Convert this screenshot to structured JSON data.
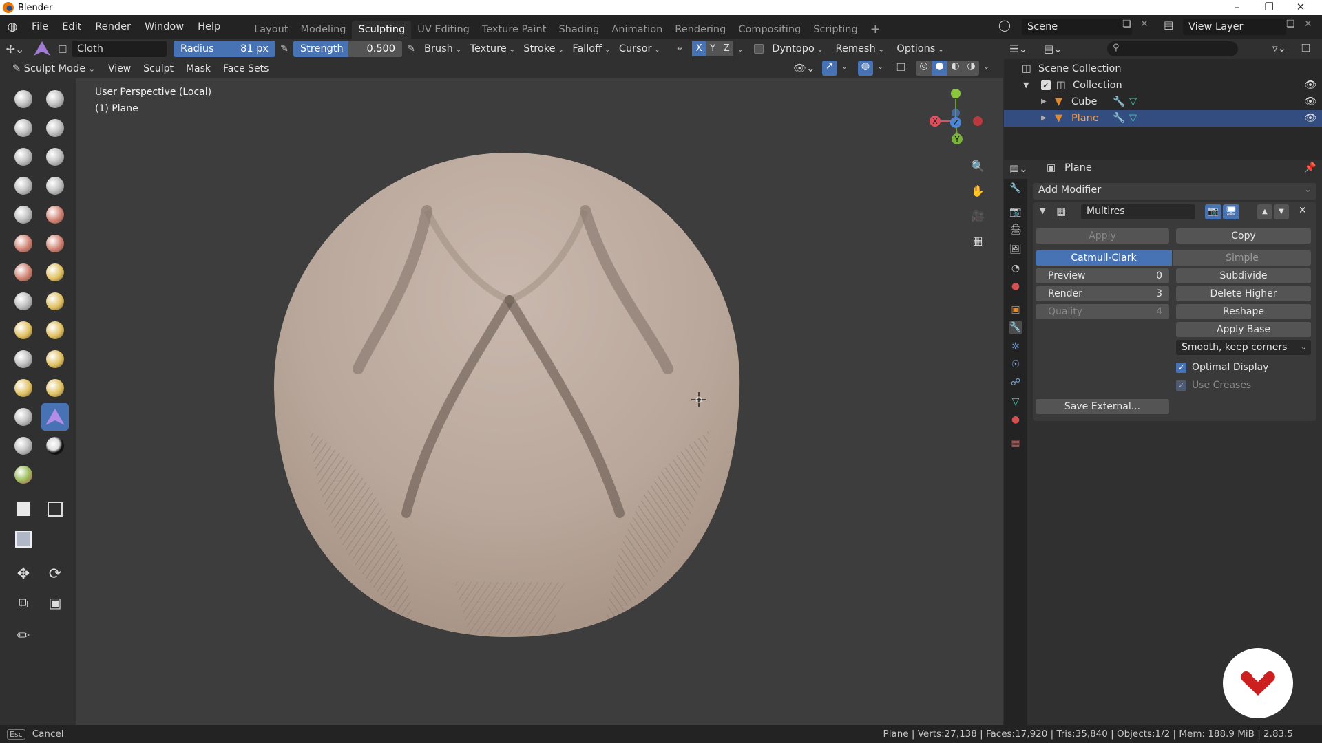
{
  "titlebar": {
    "app_title": "Blender"
  },
  "menu": {
    "items": [
      "File",
      "Edit",
      "Render",
      "Window",
      "Help"
    ]
  },
  "workspaces": {
    "tabs": [
      "Layout",
      "Modeling",
      "Sculpting",
      "UV Editing",
      "Texture Paint",
      "Shading",
      "Animation",
      "Rendering",
      "Compositing",
      "Scripting"
    ],
    "active": "Sculpting",
    "add_label": "+"
  },
  "scene": {
    "name": "Scene",
    "view_layer": "View Layer"
  },
  "brush_header": {
    "brush_name": "Cloth",
    "radius_label": "Radius",
    "radius_value": "81 px",
    "strength_label": "Strength",
    "strength_value": "0.500",
    "dropdowns": [
      "Brush",
      "Texture",
      "Stroke",
      "Falloff",
      "Cursor"
    ],
    "axes": [
      "X",
      "Y",
      "Z"
    ],
    "dyntopo": "Dyntopo",
    "remesh": "Remesh",
    "options": "Options"
  },
  "mode_header": {
    "mode": "Sculpt Mode",
    "menus": [
      "View",
      "Sculpt",
      "Mask",
      "Face Sets"
    ]
  },
  "viewport": {
    "perspective": "User Perspective (Local)",
    "object": "(1) Plane",
    "gizmo": {
      "x": "X",
      "y": "Y",
      "z": "Z"
    }
  },
  "outliner": {
    "root": "Scene Collection",
    "collection": "Collection",
    "objects": [
      {
        "name": "Cube",
        "selected": false
      },
      {
        "name": "Plane",
        "selected": true
      }
    ]
  },
  "properties": {
    "object_name": "Plane",
    "add_modifier": "Add Modifier",
    "modifier_name": "Multires",
    "apply": "Apply",
    "copy": "Copy",
    "catmull": "Catmull-Clark",
    "simple": "Simple",
    "preview_label": "Preview",
    "preview_value": "0",
    "render_label": "Render",
    "render_value": "3",
    "quality_label": "Quality",
    "quality_value": "4",
    "subdivide": "Subdivide",
    "delete_higher": "Delete Higher",
    "reshape": "Reshape",
    "apply_base": "Apply Base",
    "uv_smooth": "Smooth, keep corners",
    "optimal_display": "Optimal Display",
    "use_creases": "Use Creases",
    "save_external": "Save External..."
  },
  "statusbar": {
    "key": "Esc",
    "action": "Cancel",
    "stats": "Plane | Verts:27,138 | Faces:17,920 | Tris:35,840 | Objects:1/2 | Mem: 188.9 MiB | 2.83.5"
  },
  "colors": {
    "accent": "#4772b3",
    "selection": "#334d80",
    "object_orange": "#e0882f",
    "mesh_surface": "#bfada0"
  }
}
